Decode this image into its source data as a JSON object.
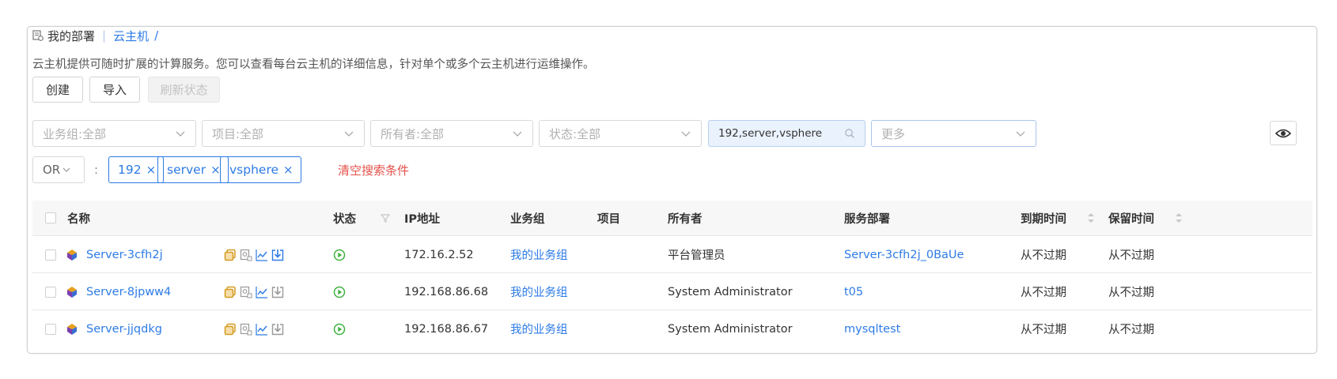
{
  "breadcrumb": {
    "root": "我的部署",
    "current": "云主机",
    "slash": "/"
  },
  "description": "云主机提供可随时扩展的计算服务。您可以查看每台云主机的详细信息，针对单个或多个云主机进行运维操作。",
  "toolbar": {
    "create": "创建",
    "import": "导入",
    "refresh": "刷新状态"
  },
  "filters": {
    "business_group": "业务组:全部",
    "project": "项目:全部",
    "owner": "所有者:全部",
    "status": "状态:全部",
    "search_value": "192,server,vsphere",
    "more": "更多"
  },
  "tagbar": {
    "operator": "OR",
    "colon": ":",
    "tags": [
      "192",
      "server",
      "vsphere"
    ],
    "clear": "清空搜索条件"
  },
  "table": {
    "headers": {
      "name": "名称",
      "status": "状态",
      "ip": "IP地址",
      "group": "业务组",
      "project": "项目",
      "owner": "所有者",
      "deployment": "服务部署",
      "expire": "到期时间",
      "retain": "保留时间"
    },
    "rows": [
      {
        "name": "Server-3cfh2j",
        "ip": "172.16.2.52",
        "group": "我的业务组",
        "project": "",
        "owner": "平台管理员",
        "deployment": "Server-3cfh2j_0BaUe",
        "expire": "从不过期",
        "retain": "从不过期",
        "export_active": true
      },
      {
        "name": "Server-8jpww4",
        "ip": "192.168.86.68",
        "group": "我的业务组",
        "project": "",
        "owner": "System Administrator",
        "deployment": "t05",
        "expire": "从不过期",
        "retain": "从不过期",
        "export_active": false
      },
      {
        "name": "Server-jjqdkg",
        "ip": "192.168.86.67",
        "group": "我的业务组",
        "project": "",
        "owner": "System Administrator",
        "deployment": "mysqltest",
        "expire": "从不过期",
        "retain": "从不过期",
        "export_active": false
      }
    ]
  },
  "colors": {
    "link": "#2d7be5",
    "running": "#3fb23f",
    "danger": "#e4504a",
    "action_copy": "#d39a1f"
  }
}
